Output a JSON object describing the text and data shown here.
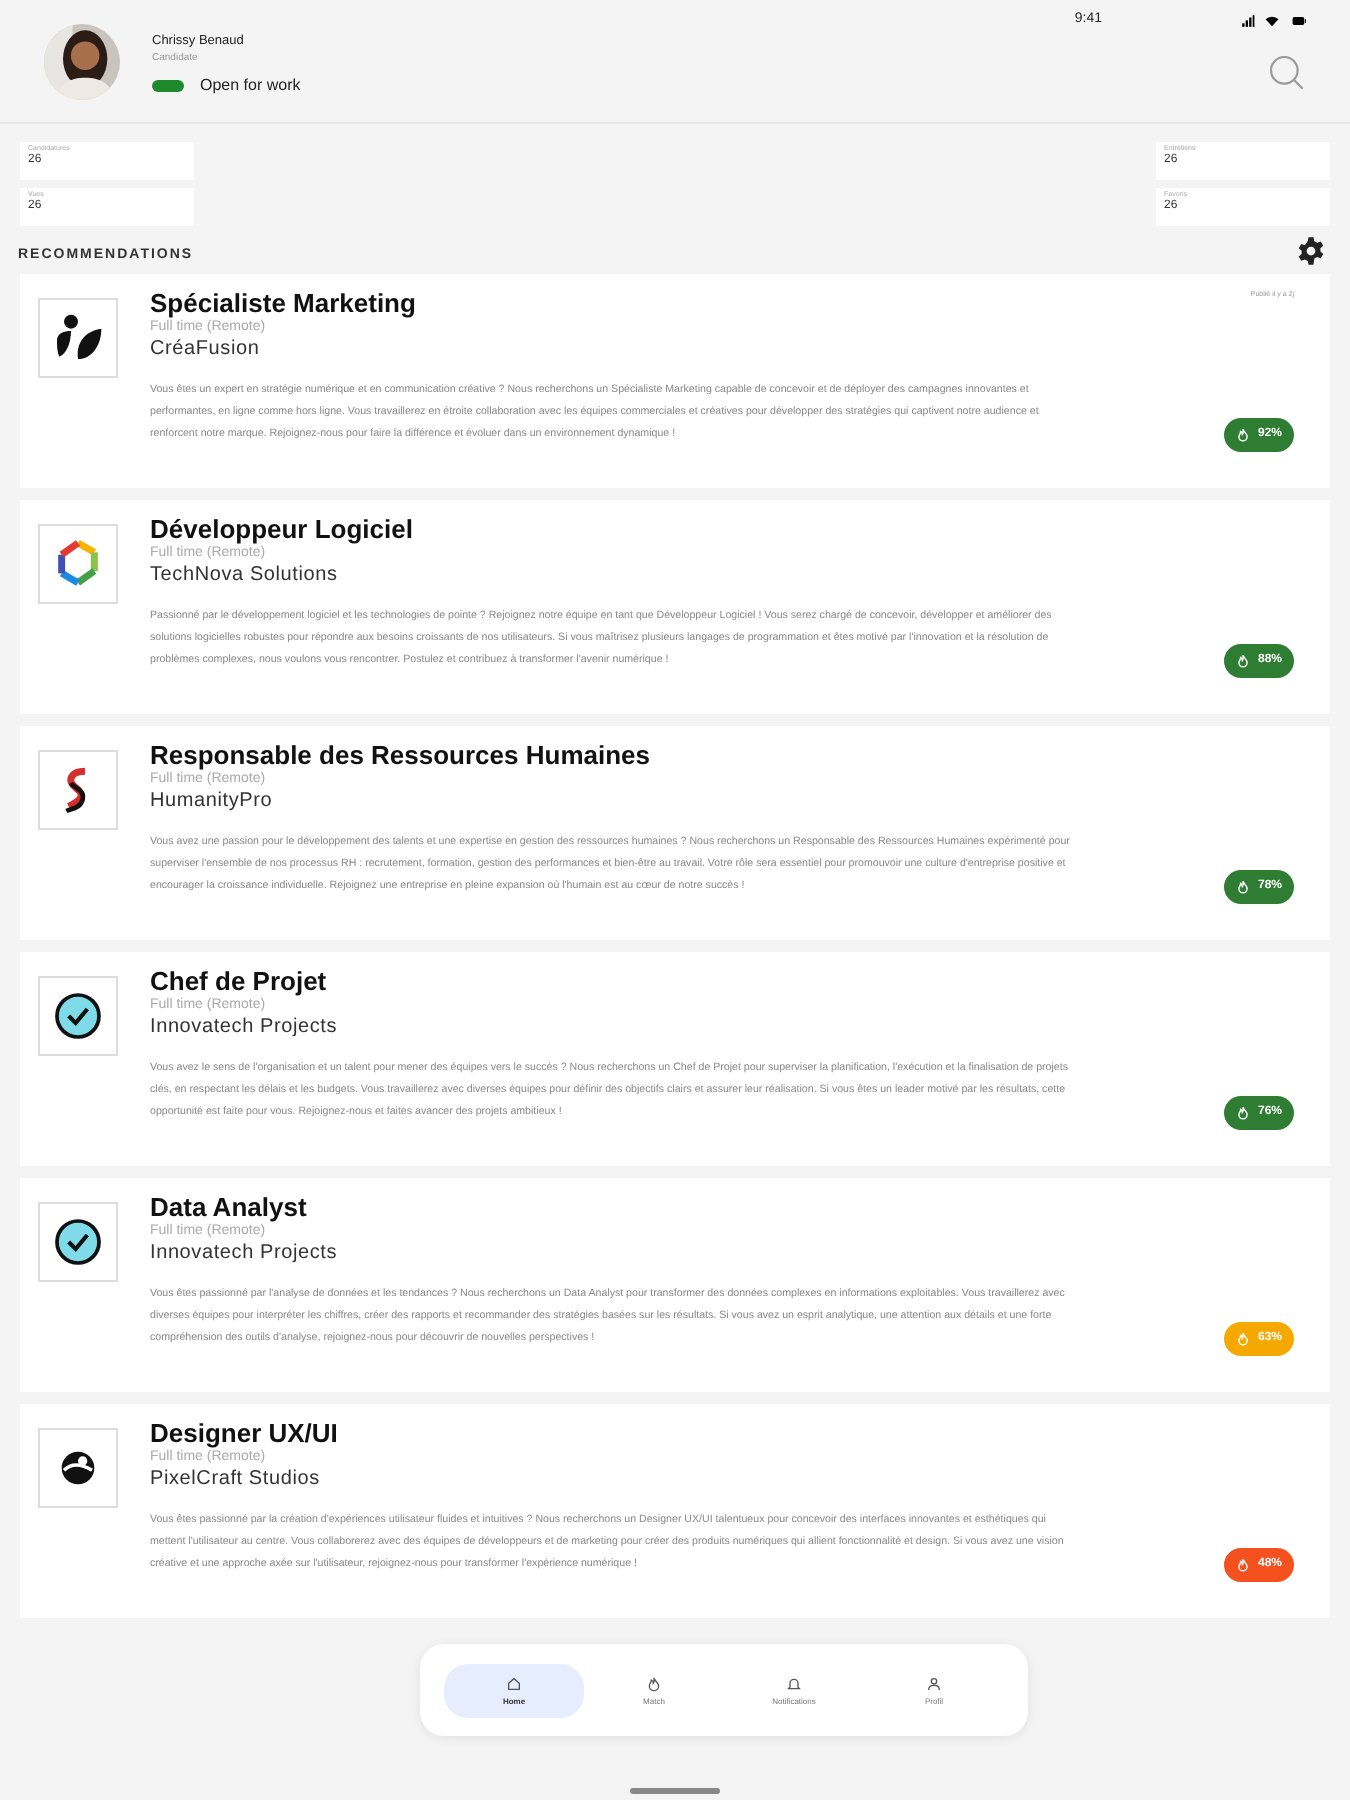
{
  "status_bar": {
    "time": "9:41"
  },
  "profile": {
    "name": "Chrissy Benaud",
    "role": "Candidate",
    "open_for_work": {
      "label": "Open for work",
      "on": true
    }
  },
  "stats": [
    {
      "label": "Candidatures",
      "value": "26"
    },
    {
      "label": "Vues",
      "value": "26"
    },
    {
      "label": "Entretiens",
      "value": "26"
    },
    {
      "label": "Favoris",
      "value": "26"
    }
  ],
  "section_title": "RECOMMENDATIONS",
  "jobs": [
    {
      "kind": "leaf",
      "title": "Spécialiste Marketing",
      "contract": "Full time (Remote)",
      "company": "CréaFusion",
      "published": "Publié il y a 2j",
      "description": "Vous êtes un expert en stratégie numérique et en communication créative ? Nous recherchons un Spécialiste Marketing capable de concevoir et de déployer des campagnes innovantes et performantes, en ligne comme hors ligne. Vous travaillerez en étroite collaboration avec les équipes commerciales et créatives pour développer des stratégies qui captivent notre audience et renforcent notre marque. Rejoignez-nous pour faire la différence et évoluer dans un environnement dynamique !",
      "match": "92%",
      "color": "#2e7d32"
    },
    {
      "kind": "hexagon",
      "title": "Développeur Logiciel",
      "contract": "Full time (Remote)",
      "company": "TechNova Solutions",
      "description": "Passionné par le développement logiciel et les technologies de pointe ? Rejoignez notre équipe en tant que Développeur Logiciel ! Vous serez chargé de concevoir, développer et améliorer des solutions logicielles robustes pour répondre aux besoins croissants de nos utilisateurs. Si vous maîtrisez plusieurs langages de programmation et êtes motivé par l'innovation et la résolution de problèmes complexes, nous voulons vous rencontrer. Postulez et contribuez à transformer l'avenir numérique !",
      "match": "88%",
      "color": "#2e7d32"
    },
    {
      "kind": "ribbon",
      "title": "Responsable des Ressources Humaines",
      "contract": "Full time (Remote)",
      "company": "HumanityPro",
      "description": "Vous avez une passion pour le développement des talents et une expertise en gestion des ressources humaines ? Nous recherchons un Responsable des Ressources Humaines expérimenté pour superviser l'ensemble de nos processus RH : recrutement, formation, gestion des performances et bien-être au travail. Votre rôle sera essentiel pour promouvoir une culture d'entreprise positive et encourager la croissance individuelle. Rejoignez une entreprise en pleine expansion où l'humain est au cœur de notre succès !",
      "match": "78%",
      "color": "#2e7d32"
    },
    {
      "kind": "check",
      "title": "Chef de Projet",
      "contract": "Full time (Remote)",
      "company": "Innovatech Projects",
      "description": "Vous avez le sens de l'organisation et un talent pour mener des équipes vers le succès ? Nous recherchons un Chef de Projet pour superviser la planification, l'exécution et la finalisation de projets clés, en respectant les délais et les budgets. Vous travaillerez avec diverses équipes pour définir des objectifs clairs et assurer leur réalisation. Si vous êtes un leader motivé par les résultats, cette opportunité est faite pour vous. Rejoignez-nous et faites avancer des projets ambitieux !",
      "match": "76%",
      "color": "#2e7d32"
    },
    {
      "kind": "check",
      "title": "Data Analyst",
      "contract": "Full time (Remote)",
      "company": "Innovatech Projects",
      "description": "Vous êtes passionné par l'analyse de données et les tendances ? Nous recherchons un Data Analyst pour transformer des données complexes en informations exploitables. Vous travaillerez avec diverses équipes pour interpréter les chiffres, créer des rapports et recommander des stratégies basées sur les résultats. Si vous avez un esprit analytique, une attention aux détails et une forte compréhension des outils d'analyse, rejoignez-nous pour découvrir de nouvelles perspectives !",
      "match": "63%",
      "color": "#f5a800"
    },
    {
      "kind": "globe",
      "title": "Designer UX/UI",
      "contract": "Full time (Remote)",
      "company": "PixelCraft Studios",
      "description": "Vous êtes passionné par la création d'expériences utilisateur fluides et intuitives ? Nous recherchons un Designer UX/UI talentueux pour concevoir des interfaces innovantes et esthétiques qui mettent l'utilisateur au centre. Vous collaborerez avec des équipes de développeurs et de marketing pour créer des produits numériques qui allient fonctionnalité et design. Si vous avez une vision créative et une approche axée sur l'utilisateur, rejoignez-nous pour transformer l'expérience numérique !",
      "match": "48%",
      "color": "#f4511e"
    }
  ],
  "bottom_nav": [
    {
      "kind": "home",
      "label": "Home",
      "selected": true
    },
    {
      "kind": "match",
      "label": "Match",
      "selected": false
    },
    {
      "kind": "bell",
      "label": "Notifications",
      "selected": false
    },
    {
      "kind": "person",
      "label": "Profil",
      "selected": false
    }
  ]
}
